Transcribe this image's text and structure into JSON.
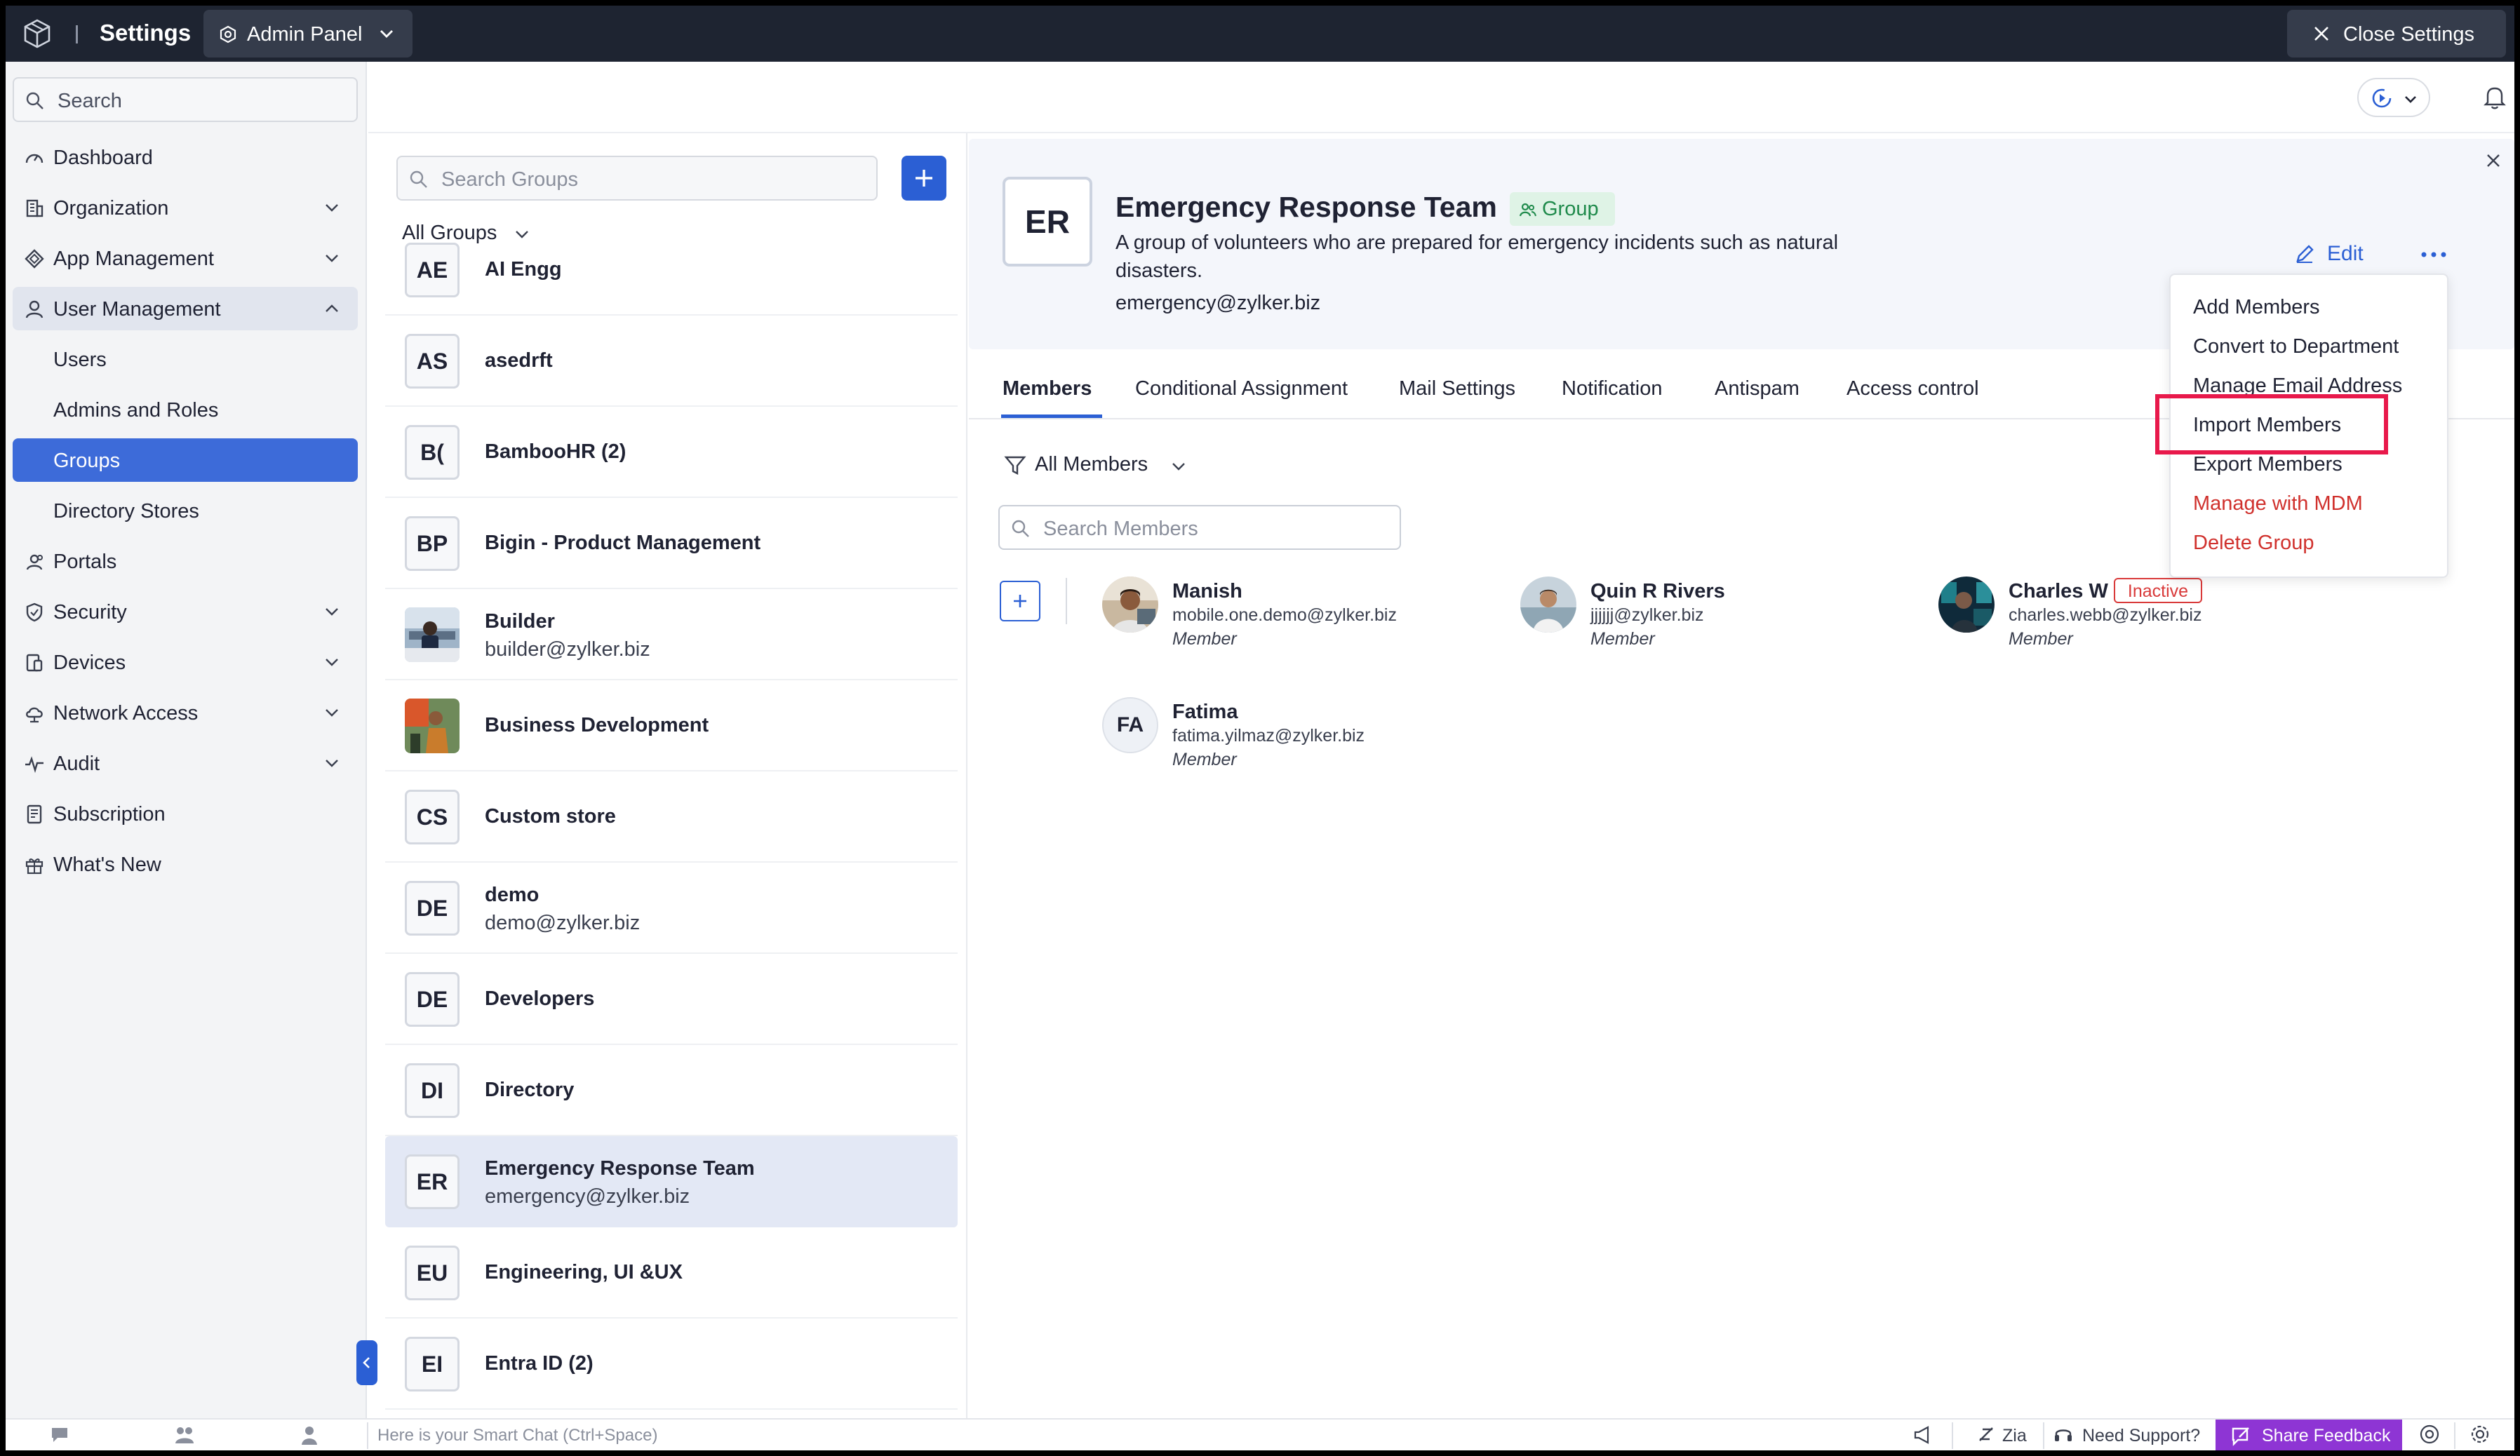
{
  "topbar": {
    "title": "Settings",
    "admin_panel": "Admin Panel",
    "close_settings": "Close Settings"
  },
  "sidebar": {
    "search_placeholder": "Search",
    "items": [
      {
        "label": "Dashboard",
        "icon": "dashboard-icon",
        "expandable": false
      },
      {
        "label": "Organization",
        "icon": "organization-icon",
        "expandable": true
      },
      {
        "label": "App Management",
        "icon": "app-management-icon",
        "expandable": true
      },
      {
        "label": "User Management",
        "icon": "user-icon",
        "expandable": true,
        "expanded": true
      },
      {
        "label": "Users",
        "sub": true
      },
      {
        "label": "Admins and Roles",
        "sub": true
      },
      {
        "label": "Groups",
        "sub": true,
        "active": true
      },
      {
        "label": "Directory Stores",
        "sub": true
      },
      {
        "label": "Portals",
        "icon": "portals-icon",
        "expandable": false
      },
      {
        "label": "Security",
        "icon": "shield-icon",
        "expandable": true
      },
      {
        "label": "Devices",
        "icon": "devices-icon",
        "expandable": true
      },
      {
        "label": "Network Access",
        "icon": "cloud-icon",
        "expandable": true
      },
      {
        "label": "Audit",
        "icon": "pulse-icon",
        "expandable": true
      },
      {
        "label": "Subscription",
        "icon": "receipt-icon",
        "expandable": false
      },
      {
        "label": "What's New",
        "icon": "gift-icon",
        "expandable": false
      }
    ]
  },
  "groups": {
    "search_placeholder": "Search Groups",
    "filter": "All Groups",
    "list": [
      {
        "initials": "AE",
        "name": "AI Engg",
        "email": ""
      },
      {
        "initials": "AS",
        "name": "asedrft",
        "email": ""
      },
      {
        "initials": "B(",
        "name": "BambooHR (2)",
        "email": ""
      },
      {
        "initials": "BP",
        "name": "Bigin - Product Management",
        "email": ""
      },
      {
        "initials": "",
        "name": "Builder",
        "email": "builder@zylker.biz",
        "photo": true
      },
      {
        "initials": "",
        "name": "Business Development",
        "email": "",
        "photo": true
      },
      {
        "initials": "CS",
        "name": "Custom store",
        "email": ""
      },
      {
        "initials": "DE",
        "name": "demo",
        "email": "demo@zylker.biz"
      },
      {
        "initials": "DE",
        "name": "Developers",
        "email": ""
      },
      {
        "initials": "DI",
        "name": "Directory",
        "email": ""
      },
      {
        "initials": "ER",
        "name": "Emergency Response Team",
        "email": "emergency@zylker.biz",
        "selected": true
      },
      {
        "initials": "EU",
        "name": "Engineering, UI &UX",
        "email": ""
      },
      {
        "initials": "EI",
        "name": "Entra ID (2)",
        "email": ""
      }
    ]
  },
  "detail": {
    "initials": "ER",
    "title": "Emergency Response Team",
    "badge": "Group",
    "description": "A group of volunteers who are prepared for emergency incidents such as natural disasters.",
    "email": "emergency@zylker.biz",
    "edit": "Edit",
    "tabs": [
      "Members",
      "Conditional Assignment",
      "Mail Settings",
      "Notification",
      "Antispam",
      "Access control"
    ],
    "active_tab": "Members",
    "member_filter": "All Members",
    "member_search_placeholder": "Search Members",
    "members": [
      {
        "name": "Manish",
        "email": "mobile.one.demo@zylker.biz",
        "role": "Member",
        "photo": true
      },
      {
        "name": "Quin R Rivers",
        "email": "jjjjjj@zylker.biz",
        "role": "Member",
        "photo": true
      },
      {
        "name": "Charles W",
        "email": "charles.webb@zylker.biz",
        "role": "Member",
        "photo": true,
        "status": "Inactive"
      },
      {
        "name": "Fatima",
        "email": "fatima.yilmaz@zylker.biz",
        "role": "Member",
        "initials": "FA"
      }
    ]
  },
  "menu": {
    "items": [
      {
        "label": "Add Members",
        "danger": false
      },
      {
        "label": "Convert to Department",
        "danger": false
      },
      {
        "label": "Manage Email Address",
        "danger": false
      },
      {
        "label": "Import Members",
        "danger": false,
        "highlighted": true
      },
      {
        "label": "Export Members",
        "danger": false
      },
      {
        "label": "Manage with MDM",
        "danger": true
      },
      {
        "label": "Delete Group",
        "danger": true
      }
    ]
  },
  "bottombar": {
    "smart_chat": "Here is your Smart Chat (Ctrl+Space)",
    "zia": "Zia",
    "need_support": "Need Support?",
    "share_feedback": "Share Feedback"
  },
  "colors": {
    "topbar": "#1e2431",
    "accent": "#2b5fd4",
    "active_nav": "#3d6bd9",
    "danger": "#d0312d",
    "highlight": "#e8194b",
    "feedback": "#8e35d4",
    "group_badge": "#1f8a4b"
  }
}
